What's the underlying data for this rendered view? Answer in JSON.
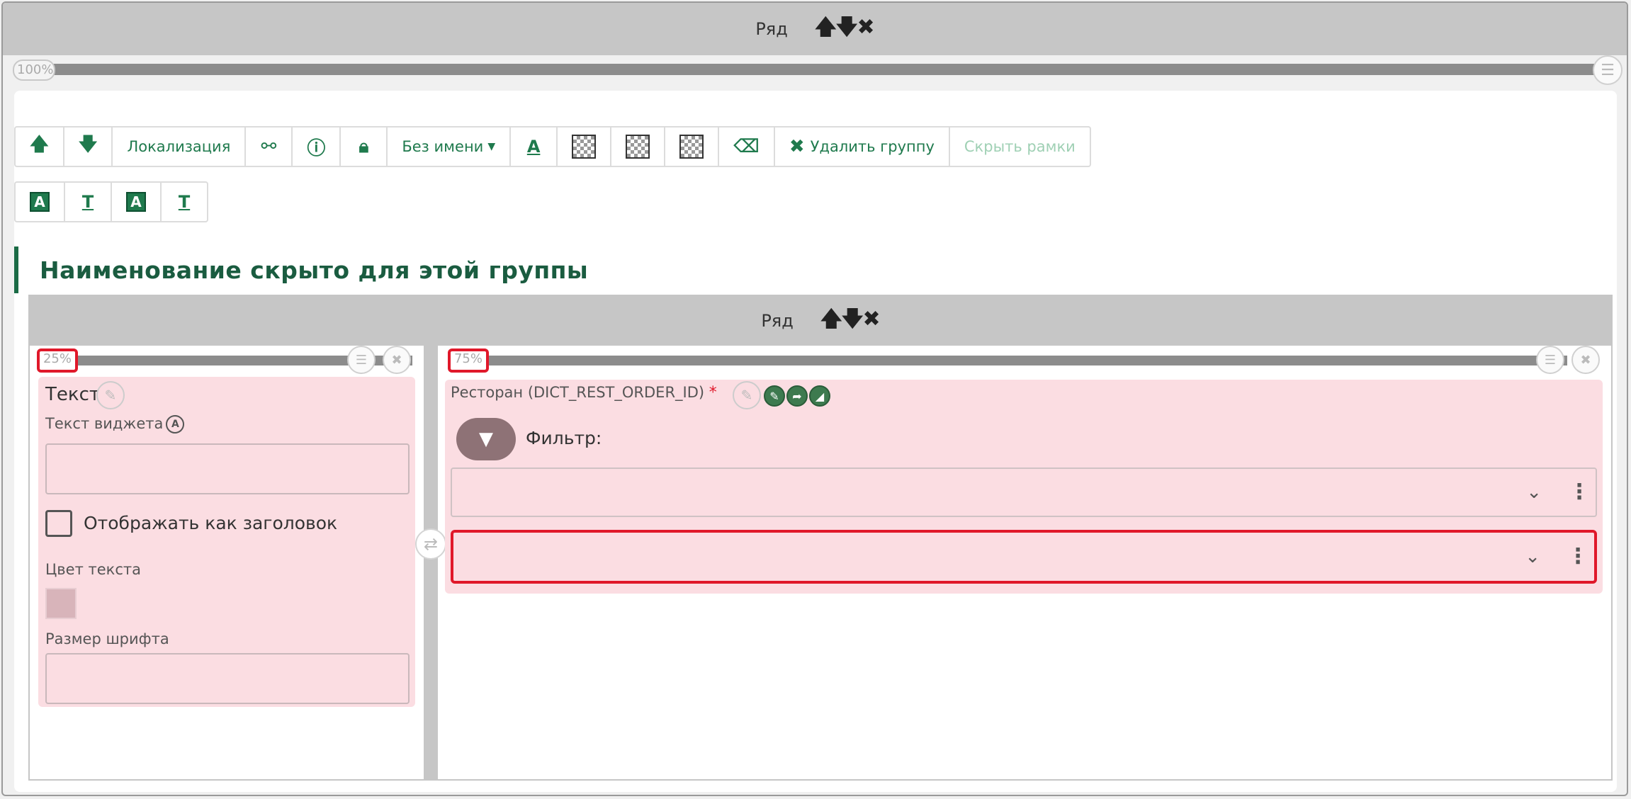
{
  "outer_row": {
    "label": "Ряд",
    "controls": {
      "up": "🡅",
      "down": "🡇",
      "remove": "✖"
    },
    "width_percent": "100%"
  },
  "toolbar": {
    "localization": "Локализация",
    "name_dropdown": "Без имени",
    "delete_group": "Удалить группу",
    "hide_borders": "Скрыть рамки"
  },
  "group_title": "Наименование скрыто для этой группы",
  "inner_row": {
    "label": "Ряд",
    "controls": {
      "up": "🡅",
      "down": "🡇",
      "remove": "✖"
    }
  },
  "left_column": {
    "width_percent": "25%",
    "widget_title": "Текст",
    "widget_text_label": "Текст виджета",
    "widget_text_value": "",
    "show_as_heading_label": "Отображать как заголовок",
    "show_as_heading_checked": false,
    "text_color_label": "Цвет текста",
    "font_size_label": "Размер шрифта",
    "font_size_value": ""
  },
  "right_column": {
    "width_percent": "75%",
    "field_label": "Ресторан (DICT_REST_ORDER_ID)",
    "required_mark": "*",
    "filter_label": "Фильтр:",
    "select1_value": "",
    "select2_value": ""
  },
  "colors": {
    "accent": "#1f7a4d",
    "error": "#e0182a",
    "card_bg": "#fbdde2",
    "row_header": "#c6c6c6"
  }
}
